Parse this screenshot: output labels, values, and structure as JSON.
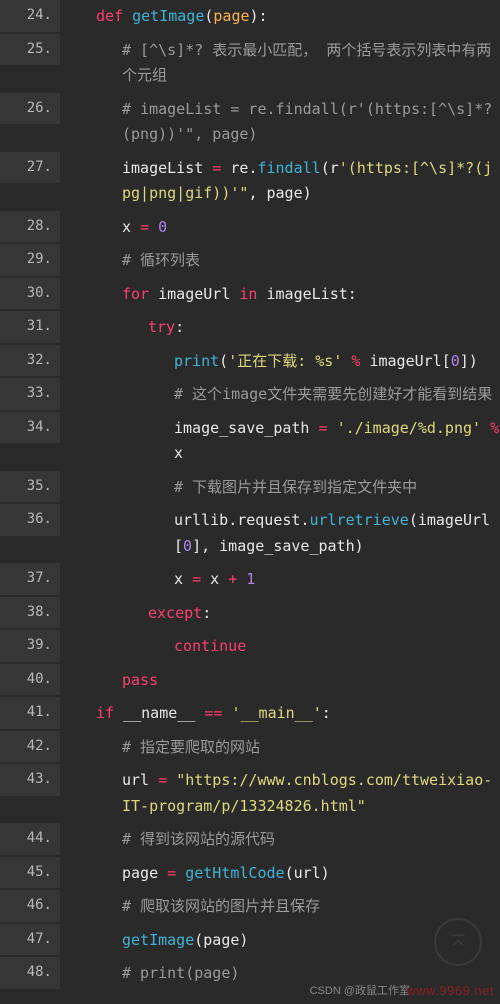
{
  "watermarks": {
    "csdn": "CSDN @政鼠工作室",
    "site": "www.9969.net"
  },
  "code": {
    "lines": [
      {
        "n": "24.",
        "indent": 1,
        "tokens": [
          [
            "kw",
            "def "
          ],
          [
            "fn",
            "getImage"
          ],
          [
            "id",
            "("
          ],
          [
            "param",
            "page"
          ],
          [
            "id",
            "):"
          ]
        ]
      },
      {
        "n": "25.",
        "indent": 2,
        "tokens": [
          [
            "cmt",
            "# [^\\s]*? 表示最小匹配，  两个括号表示列表中有两个元组"
          ]
        ]
      },
      {
        "n": "26.",
        "indent": 2,
        "tokens": [
          [
            "cmt",
            "# imageList = re.findall(r'(https:[^\\s]*?(png))'\", page)"
          ]
        ]
      },
      {
        "n": "27.",
        "indent": 2,
        "tokens": [
          [
            "id",
            "imageList "
          ],
          [
            "op",
            "="
          ],
          [
            "id",
            " re"
          ],
          [
            "id",
            "."
          ],
          [
            "fn",
            "findall"
          ],
          [
            "id",
            "(r"
          ],
          [
            "str",
            "'(https:[^\\s]*?(jpg|png|gif))'\""
          ],
          [
            "id",
            ", page)"
          ]
        ]
      },
      {
        "n": "28.",
        "indent": 2,
        "tokens": [
          [
            "id",
            "x "
          ],
          [
            "op",
            "="
          ],
          [
            "id",
            " "
          ],
          [
            "num",
            "0"
          ]
        ]
      },
      {
        "n": "29.",
        "indent": 2,
        "tokens": [
          [
            "cmt",
            "# 循环列表"
          ]
        ]
      },
      {
        "n": "30.",
        "indent": 2,
        "tokens": [
          [
            "kw",
            "for "
          ],
          [
            "id",
            "imageUrl "
          ],
          [
            "kw",
            "in "
          ],
          [
            "id",
            "imageList:"
          ]
        ]
      },
      {
        "n": "31.",
        "indent": 3,
        "tokens": [
          [
            "kw",
            "try"
          ],
          [
            "id",
            ":"
          ]
        ]
      },
      {
        "n": "32.",
        "indent": 4,
        "tokens": [
          [
            "fn",
            "print"
          ],
          [
            "id",
            "("
          ],
          [
            "str",
            "'正在下载: %s'"
          ],
          [
            "id",
            " "
          ],
          [
            "op",
            "%"
          ],
          [
            "id",
            " imageUrl["
          ],
          [
            "num",
            "0"
          ],
          [
            "id",
            "])"
          ]
        ]
      },
      {
        "n": "33.",
        "indent": 4,
        "tokens": [
          [
            "cmt",
            "# 这个image文件夹需要先创建好才能看到结果"
          ]
        ]
      },
      {
        "n": "34.",
        "indent": 4,
        "tokens": [
          [
            "id",
            "image_save_path "
          ],
          [
            "op",
            "="
          ],
          [
            "id",
            " "
          ],
          [
            "str",
            "'./image/%d.png'"
          ],
          [
            "id",
            " "
          ],
          [
            "op",
            "%"
          ],
          [
            "id",
            " x"
          ]
        ]
      },
      {
        "n": "35.",
        "indent": 4,
        "tokens": [
          [
            "cmt",
            "# 下载图片并且保存到指定文件夹中"
          ]
        ]
      },
      {
        "n": "36.",
        "indent": 4,
        "tokens": [
          [
            "id",
            "urllib"
          ],
          [
            "id",
            "."
          ],
          [
            "id",
            "request"
          ],
          [
            "id",
            "."
          ],
          [
            "fn",
            "urlretrieve"
          ],
          [
            "id",
            "(imageUrl["
          ],
          [
            "num",
            "0"
          ],
          [
            "id",
            "], image_save_path)"
          ]
        ]
      },
      {
        "n": "37.",
        "indent": 4,
        "tokens": [
          [
            "id",
            "x "
          ],
          [
            "op",
            "="
          ],
          [
            "id",
            " x "
          ],
          [
            "op",
            "+"
          ],
          [
            "id",
            " "
          ],
          [
            "num",
            "1"
          ]
        ]
      },
      {
        "n": "38.",
        "indent": 3,
        "tokens": [
          [
            "kw",
            "except"
          ],
          [
            "id",
            ":"
          ]
        ]
      },
      {
        "n": "39.",
        "indent": 4,
        "tokens": [
          [
            "kw",
            "continue"
          ]
        ]
      },
      {
        "n": "40.",
        "indent": 2,
        "tokens": [
          [
            "kw",
            "pass"
          ]
        ]
      },
      {
        "n": "41.",
        "indent": 1,
        "tokens": [
          [
            "kw",
            "if "
          ],
          [
            "id",
            "__name__ "
          ],
          [
            "op",
            "=="
          ],
          [
            "id",
            " "
          ],
          [
            "str",
            "'__main__'"
          ],
          [
            "id",
            ":"
          ]
        ]
      },
      {
        "n": "42.",
        "indent": 2,
        "tokens": [
          [
            "cmt",
            "# 指定要爬取的网站"
          ]
        ]
      },
      {
        "n": "43.",
        "indent": 2,
        "tokens": [
          [
            "id",
            "url "
          ],
          [
            "op",
            "="
          ],
          [
            "id",
            " "
          ],
          [
            "str",
            "\"https://www.cnblogs.com/ttweixiao-IT-program/p/13324826.html\""
          ]
        ]
      },
      {
        "n": "44.",
        "indent": 2,
        "tokens": [
          [
            "cmt",
            "# 得到该网站的源代码"
          ]
        ]
      },
      {
        "n": "45.",
        "indent": 2,
        "tokens": [
          [
            "id",
            "page "
          ],
          [
            "op",
            "="
          ],
          [
            "id",
            " "
          ],
          [
            "fn",
            "getHtmlCode"
          ],
          [
            "id",
            "(url)"
          ]
        ]
      },
      {
        "n": "46.",
        "indent": 2,
        "tokens": [
          [
            "cmt",
            "# 爬取该网站的图片并且保存"
          ]
        ]
      },
      {
        "n": "47.",
        "indent": 2,
        "tokens": [
          [
            "fn",
            "getImage"
          ],
          [
            "id",
            "(page)"
          ]
        ]
      },
      {
        "n": "48.",
        "indent": 2,
        "tokens": [
          [
            "cmt",
            "# print(page)"
          ]
        ]
      }
    ]
  }
}
